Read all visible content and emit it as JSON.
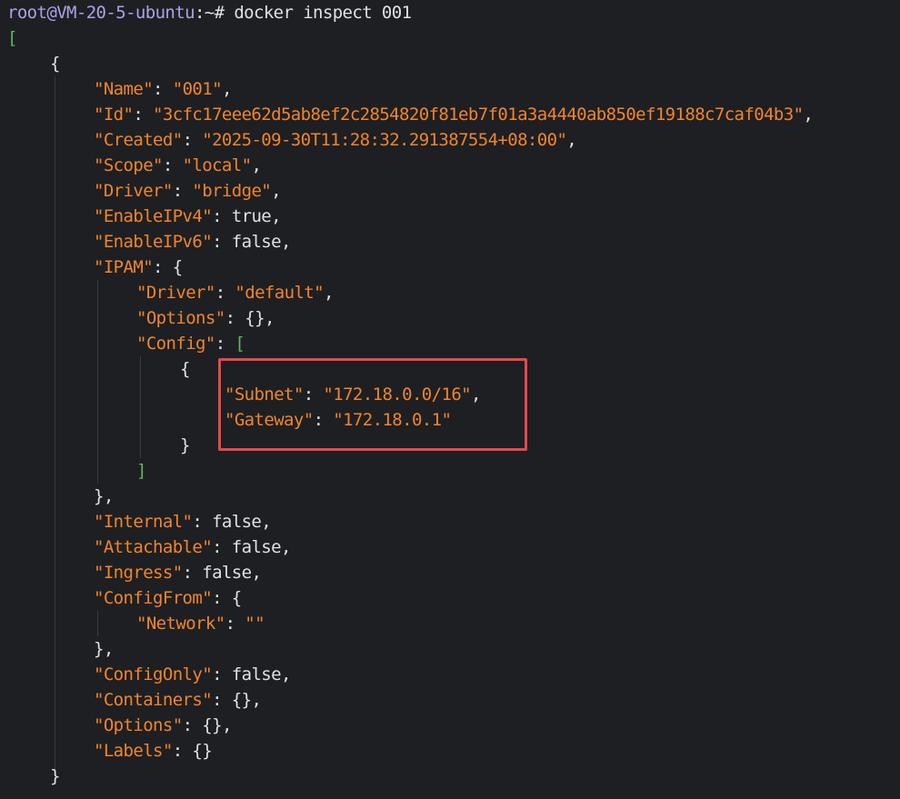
{
  "prompt": {
    "user_host": "root@VM-20-5-ubuntu",
    "path_sym": ":~#",
    "command": "docker inspect 001"
  },
  "output": {
    "open_array": "[",
    "open_obj": "{",
    "fields": {
      "name": {
        "key": "\"Name\"",
        "value": "\"001\""
      },
      "id": {
        "key": "\"Id\"",
        "value": "\"3cfc17eee62d5ab8ef2c2854820f81eb7f01a3a4440ab850ef19188c7caf04b3\""
      },
      "created": {
        "key": "\"Created\"",
        "value": "\"2025-09-30T11:28:32.291387554+08:00\""
      },
      "scope": {
        "key": "\"Scope\"",
        "value": "\"local\""
      },
      "driver": {
        "key": "\"Driver\"",
        "value": "\"bridge\""
      },
      "enable_ipv4": {
        "key": "\"EnableIPv4\"",
        "value": "true"
      },
      "enable_ipv6": {
        "key": "\"EnableIPv6\"",
        "value": "false"
      },
      "ipam": {
        "key": "\"IPAM\""
      },
      "ipam_driver": {
        "key": "\"Driver\"",
        "value": "\"default\""
      },
      "ipam_options": {
        "key": "\"Options\"",
        "value": "{}"
      },
      "ipam_config": {
        "key": "\"Config\""
      },
      "subnet": {
        "key": "\"Subnet\"",
        "value": "\"172.18.0.0/16\""
      },
      "gateway": {
        "key": "\"Gateway\"",
        "value": "\"172.18.0.1\""
      },
      "internal": {
        "key": "\"Internal\"",
        "value": "false"
      },
      "attachable": {
        "key": "\"Attachable\"",
        "value": "false"
      },
      "ingress": {
        "key": "\"Ingress\"",
        "value": "false"
      },
      "config_from": {
        "key": "\"ConfigFrom\""
      },
      "network": {
        "key": "\"Network\"",
        "value": "\"\""
      },
      "config_only": {
        "key": "\"ConfigOnly\"",
        "value": "false"
      },
      "containers": {
        "key": "\"Containers\"",
        "value": "{}"
      },
      "options": {
        "key": "\"Options\"",
        "value": "{}"
      },
      "labels": {
        "key": "\"Labels\"",
        "value": "{}"
      }
    },
    "close_obj": "}"
  },
  "colors": {
    "background": "#1e1f22",
    "prompt": "#a8a3e8",
    "string": "#f0852d",
    "bracket": "#5fb85f",
    "text": "#dfe1e5",
    "highlight_border": "#e5484d"
  }
}
